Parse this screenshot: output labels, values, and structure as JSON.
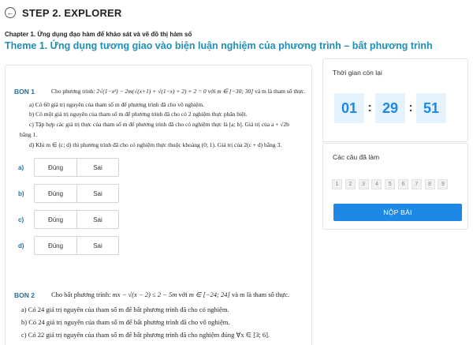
{
  "header": {
    "back_icon": "arrow-left-icon",
    "title": "STEP 2. EXPLORER"
  },
  "chapter": "Chapter 1. Ứng dụng đạo hàm để khảo sát và vẽ đồ thị hàm số",
  "theme": "Theme 1. Ứng dụng tương giao vào biện luận nghiệm của phương trình – bất phương trình",
  "questions": [
    {
      "label": "BON 1",
      "stem_pre": "Cho phương trình: ",
      "stem_math": "2√(1−x²) − 2m(√(x+1) + √(1−x) + 2) + 2 = 0",
      "stem_mid": " với ",
      "stem_math2": "m ∈ [−30; 30]",
      "stem_post": " và m là tham số thực.",
      "statements": [
        "a) Có 60 giá trị nguyên của tham số m để phương trình đã cho vô nghiệm.",
        "b) Có một giá trị nguyên của tham số m để phương trình đã cho có 2 nghiệm thực phân biệt.",
        "c) Tập hợp các giá trị thực của tham số m để phương trình đã cho có nghiệm thực là [a; b]. Giá trị của a + √2b",
        "bằng 1.",
        "d) Khi m ∈ (c; d) thì phương trình đã cho có nghiệm thực thuộc khoảng (0; 1). Giá trị của 2(c + d) bằng 3."
      ],
      "answers": [
        {
          "letter": "a)",
          "true_label": "Đúng",
          "false_label": "Sai"
        },
        {
          "letter": "b)",
          "true_label": "Đúng",
          "false_label": "Sai"
        },
        {
          "letter": "c)",
          "true_label": "Đúng",
          "false_label": "Sai"
        },
        {
          "letter": "d)",
          "true_label": "Đúng",
          "false_label": "Sai"
        }
      ]
    },
    {
      "label": "BON 2",
      "stem_pre": "Cho bất phương trình: ",
      "stem_math": "mx − √(x − 2) ≤ 2 − 5m",
      "stem_mid": " với ",
      "stem_math2": "m ∈ [−24; 24]",
      "stem_post": " và m là tham số thực.",
      "statements": [
        "a) Có 24 giá trị nguyên của tham số m để bất phương trình đã cho có nghiệm.",
        "b) Có 24 giá trị nguyên của tham số m để bất phương trình đã cho vô nghiệm.",
        "c) Có 22 giá trị nguyên của tham số m để bất phương trình đã cho nghiệm đúng ∀x ∈ [3; 6]."
      ]
    }
  ],
  "sidebar": {
    "timer_title": "Thời gian còn lại",
    "timer": {
      "hours": "01",
      "minutes": "29",
      "seconds": "51",
      "separator": ":"
    },
    "done_title": "Các câu đã làm",
    "question_numbers": [
      "1",
      "2",
      "3",
      "4",
      "5",
      "6",
      "7",
      "8",
      "9"
    ],
    "submit_label": "NỘP BÀI"
  }
}
